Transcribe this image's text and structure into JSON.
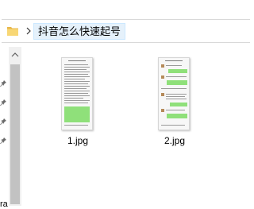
{
  "addressbar": {
    "crumb": "抖音怎么快速起号",
    "folder_icon": "folder-icon",
    "separator_icon": "chevron-right-icon"
  },
  "navpane": {
    "partial_label": "ra",
    "pin_icon": "pin-icon",
    "pin_count": 4
  },
  "files": [
    {
      "name": "1.jpg",
      "type": "image-thumbnail"
    },
    {
      "name": "2.jpg",
      "type": "image-thumbnail"
    }
  ],
  "colors": {
    "selection_bg": "#e5f1fb",
    "selection_border": "#cce8ff",
    "folder": "#f8d775",
    "chat_green": "#8fe07a",
    "scrollbar_thumb": "#c2c2c2"
  }
}
